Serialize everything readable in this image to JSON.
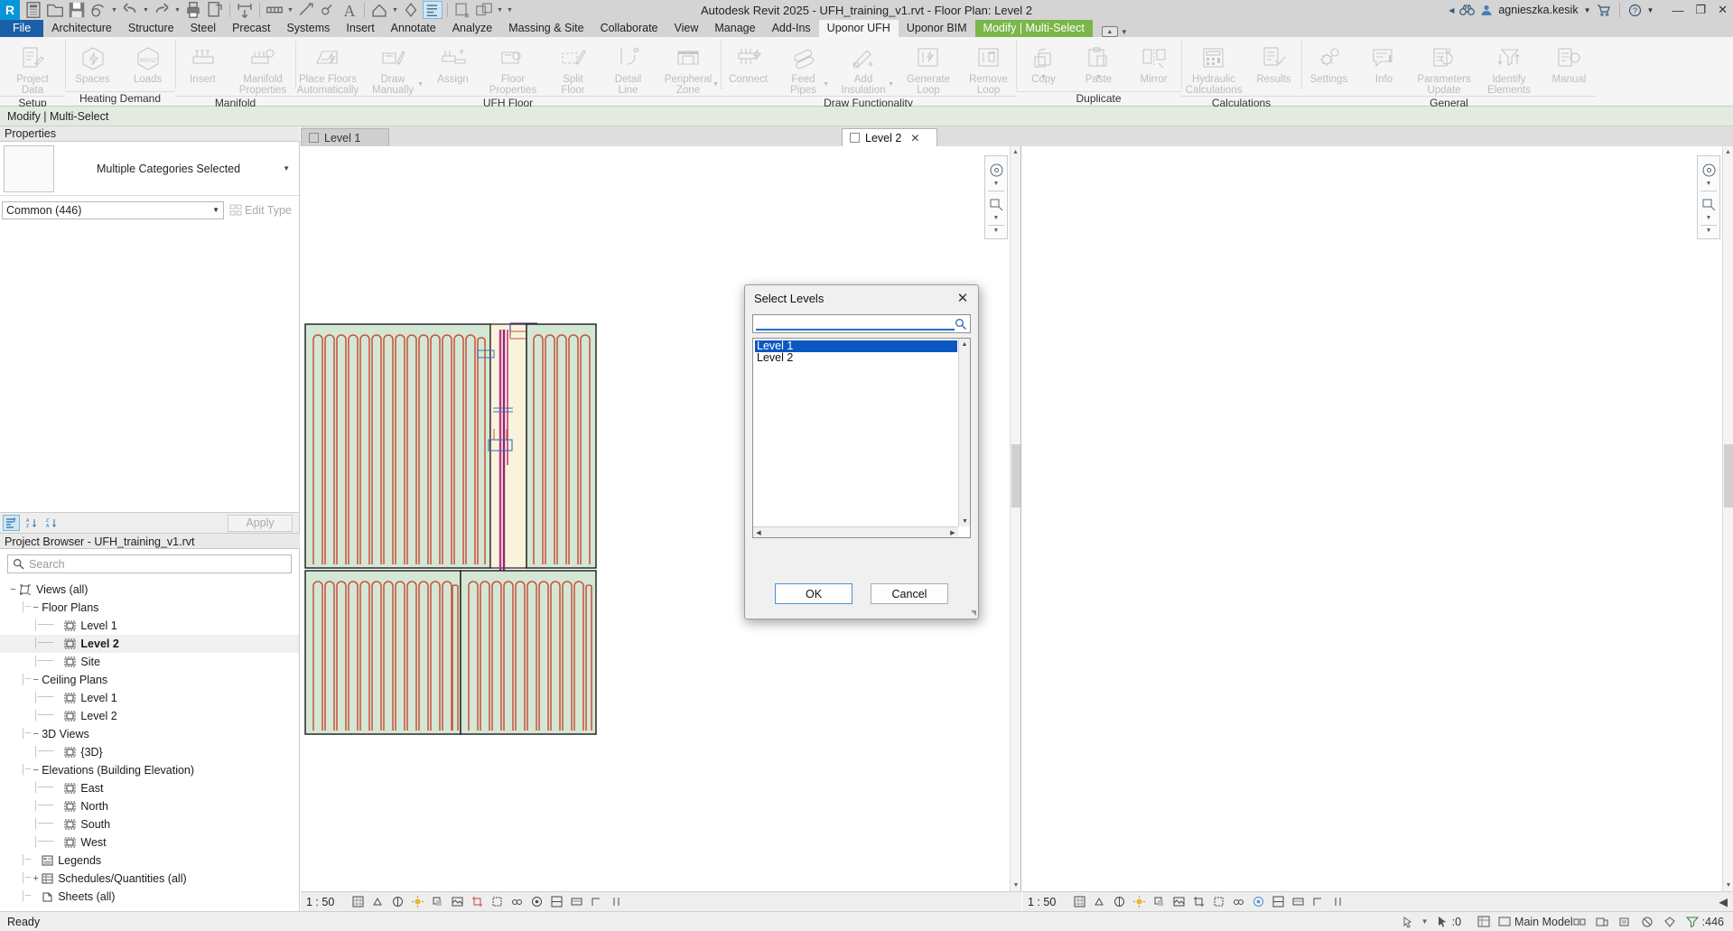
{
  "title_bar": {
    "app_title": "Autodesk Revit 2025 - UFH_training_v1.rvt - Floor Plan: Level 2",
    "user_name": "agnieszka.kesik",
    "quick_access": [
      {
        "name": "revit-logo",
        "label": "R"
      },
      {
        "name": "project-data-icon",
        "label": ""
      },
      {
        "name": "open-icon",
        "label": ""
      },
      {
        "name": "save-icon",
        "label": ""
      },
      {
        "name": "sync-icon",
        "label": ""
      },
      {
        "name": "undo-icon",
        "label": ""
      },
      {
        "name": "redo-icon",
        "label": ""
      },
      {
        "name": "print-icon",
        "label": ""
      },
      {
        "name": "measure-icon",
        "label": ""
      },
      {
        "name": "aligned-dimension-icon",
        "label": ""
      },
      {
        "name": "tag-icon",
        "label": ""
      },
      {
        "name": "text-icon",
        "label": ""
      },
      {
        "name": "default-3d-view-icon",
        "label": ""
      },
      {
        "name": "section-icon",
        "label": ""
      },
      {
        "name": "thin-lines-icon",
        "label": ""
      },
      {
        "name": "close-hidden-windows-icon",
        "label": ""
      },
      {
        "name": "switch-windows-icon",
        "label": ""
      }
    ],
    "window_buttons": {
      "minimize": "—",
      "restore": "❐",
      "close": "✕"
    }
  },
  "ribbon_tabs": {
    "file": "File",
    "tabs": [
      "Architecture",
      "Structure",
      "Steel",
      "Precast",
      "Systems",
      "Insert",
      "Annotate",
      "Analyze",
      "Massing & Site",
      "Collaborate",
      "View",
      "Manage",
      "Add-Ins"
    ],
    "active_tab": "Uponor UFH",
    "secondary_tab": "Uponor BIM",
    "context_tab": "Modify | Multi-Select"
  },
  "ribbon": {
    "groups": [
      {
        "title": "Setup",
        "buttons": [
          {
            "name": "project-data-button",
            "label": "Project\nData",
            "icon": "document-edit-icon",
            "dropdown": "none"
          }
        ]
      },
      {
        "title": "Heating Demand",
        "buttons": [
          {
            "name": "spaces-button",
            "label": "Spaces",
            "icon": "space-bolt-icon",
            "dropdown": "none"
          },
          {
            "name": "loads-button",
            "label": "Loads",
            "icon": "space-wm2-icon",
            "dropdown": "none"
          }
        ]
      },
      {
        "title": "Manifold",
        "buttons": [
          {
            "name": "insert-manifold-button",
            "label": "Insert",
            "icon": "manifold-icon",
            "dropdown": "none"
          },
          {
            "name": "manifold-properties-button",
            "label": "Manifold\nProperties",
            "icon": "manifold-gear-icon",
            "dropdown": "none"
          }
        ]
      },
      {
        "title": "UFH Floor",
        "buttons": [
          {
            "name": "place-floors-automatically-button",
            "label": "Place Floors\nAutomatically",
            "icon": "floor-bolt-icon",
            "dropdown": "none"
          },
          {
            "name": "draw-manually-button",
            "label": "Draw\nManually",
            "icon": "floor-pencil-icon",
            "dropdown": "side"
          },
          {
            "name": "assign-button",
            "label": "Assign",
            "icon": "manifold-plus-icon",
            "dropdown": "none"
          },
          {
            "name": "floor-properties-button",
            "label": "Floor\nProperties",
            "icon": "floor-gear-icon",
            "dropdown": "none"
          },
          {
            "name": "split-floor-button",
            "label": "Split\nFloor",
            "icon": "split-floor-icon",
            "dropdown": "none"
          },
          {
            "name": "detail-line-button",
            "label": "Detail\nLine",
            "icon": "detail-line-icon",
            "dropdown": "none"
          },
          {
            "name": "peripheral-zone-button",
            "label": "Peripheral\nZone",
            "icon": "peripheral-zone-icon",
            "dropdown": "side"
          }
        ]
      },
      {
        "title": "Draw Functionality",
        "buttons": [
          {
            "name": "connect-button",
            "label": "Connect",
            "icon": "manifold-connect-icon",
            "dropdown": "none"
          },
          {
            "name": "feed-pipes-button",
            "label": "Feed\nPipes",
            "icon": "pipes-icon",
            "dropdown": "side"
          },
          {
            "name": "add-insulation-button",
            "label": "Add\nInsulation",
            "icon": "insulation-plus-icon",
            "dropdown": "side"
          },
          {
            "name": "generate-loop-button",
            "label": "Generate\nLoop",
            "icon": "loop-bolt-icon",
            "dropdown": "none"
          },
          {
            "name": "remove-loop-button",
            "label": "Remove\nLoop",
            "icon": "loop-trash-icon",
            "dropdown": "none"
          }
        ]
      },
      {
        "title": "Duplicate",
        "buttons": [
          {
            "name": "copy-button",
            "label": "Copy",
            "icon": "copy-icon",
            "dropdown": "below"
          },
          {
            "name": "paste-button",
            "label": "Paste",
            "icon": "paste-icon",
            "dropdown": "below"
          },
          {
            "name": "mirror-button",
            "label": "Mirror",
            "icon": "mirror-icon",
            "dropdown": "none"
          }
        ]
      },
      {
        "title": "Calculations",
        "buttons": [
          {
            "name": "hydraulic-calculations-button",
            "label": "Hydraulic\nCalculations",
            "icon": "calculator-icon",
            "dropdown": "none"
          },
          {
            "name": "results-button",
            "label": "Results",
            "icon": "results-check-icon",
            "dropdown": "none"
          }
        ]
      },
      {
        "title": "General",
        "buttons": [
          {
            "name": "settings-button",
            "label": "Settings",
            "icon": "gear-icon",
            "dropdown": "none"
          },
          {
            "name": "info-button",
            "label": "Info",
            "icon": "info-bubble-icon",
            "dropdown": "none"
          },
          {
            "name": "parameters-update-button",
            "label": "Parameters\nUpdate",
            "icon": "document-refresh-icon",
            "dropdown": "none"
          },
          {
            "name": "identify-elements-button",
            "label": "Identify\nElements",
            "icon": "filter-arrows-icon",
            "dropdown": "none"
          },
          {
            "name": "manual-button",
            "label": "Manual",
            "icon": "document-gear-icon",
            "dropdown": "none"
          }
        ]
      }
    ]
  },
  "options_bar": {
    "text": "Modify | Multi-Select"
  },
  "properties": {
    "header": "Properties",
    "type_label": "Multiple Categories Selected",
    "instance_selector": "Common (446)",
    "edit_type_label": "Edit Type",
    "apply_label": "Apply",
    "toolbar_icons": [
      "properties-list-icon",
      "sort-ascending-icon",
      "sort-descending-icon"
    ]
  },
  "project_browser": {
    "header": "Project Browser - UFH_training_v1.rvt",
    "search_placeholder": "Search",
    "tree": [
      {
        "label": "Views (all)",
        "depth": 0,
        "expander": "−",
        "icon": "views-icon",
        "selected": false,
        "bold": false
      },
      {
        "label": "Floor Plans",
        "depth": 1,
        "expander": "−",
        "icon": "none",
        "selected": false,
        "bold": false
      },
      {
        "label": "Level 1",
        "depth": 2,
        "expander": "",
        "icon": "view-icon",
        "selected": false,
        "bold": false
      },
      {
        "label": "Level 2",
        "depth": 2,
        "expander": "",
        "icon": "view-icon",
        "selected": true,
        "bold": true
      },
      {
        "label": "Site",
        "depth": 2,
        "expander": "",
        "icon": "view-icon",
        "selected": false,
        "bold": false
      },
      {
        "label": "Ceiling Plans",
        "depth": 1,
        "expander": "−",
        "icon": "none",
        "selected": false,
        "bold": false
      },
      {
        "label": "Level 1",
        "depth": 2,
        "expander": "",
        "icon": "view-icon",
        "selected": false,
        "bold": false
      },
      {
        "label": "Level 2",
        "depth": 2,
        "expander": "",
        "icon": "view-icon",
        "selected": false,
        "bold": false
      },
      {
        "label": "3D Views",
        "depth": 1,
        "expander": "−",
        "icon": "none",
        "selected": false,
        "bold": false
      },
      {
        "label": "{3D}",
        "depth": 2,
        "expander": "",
        "icon": "view-icon",
        "selected": false,
        "bold": false
      },
      {
        "label": "Elevations (Building Elevation)",
        "depth": 1,
        "expander": "−",
        "icon": "none",
        "selected": false,
        "bold": false
      },
      {
        "label": "East",
        "depth": 2,
        "expander": "",
        "icon": "view-icon",
        "selected": false,
        "bold": false
      },
      {
        "label": "North",
        "depth": 2,
        "expander": "",
        "icon": "view-icon",
        "selected": false,
        "bold": false
      },
      {
        "label": "South",
        "depth": 2,
        "expander": "",
        "icon": "view-icon",
        "selected": false,
        "bold": false
      },
      {
        "label": "West",
        "depth": 2,
        "expander": "",
        "icon": "view-icon",
        "selected": false,
        "bold": false
      },
      {
        "label": "Legends",
        "depth": 1,
        "expander": "",
        "icon": "legend-icon",
        "selected": false,
        "bold": false
      },
      {
        "label": "Schedules/Quantities (all)",
        "depth": 1,
        "expander": "+",
        "icon": "schedule-icon",
        "selected": false,
        "bold": false
      },
      {
        "label": "Sheets (all)",
        "depth": 1,
        "expander": "",
        "icon": "sheet-icon",
        "selected": false,
        "bold": false
      }
    ]
  },
  "view_tabs": [
    {
      "label": "Level 1",
      "active": false,
      "closable": false
    },
    {
      "label": "Level 2",
      "active": true,
      "closable": true
    }
  ],
  "view_control_bars": {
    "left": {
      "scale": "1 : 50"
    },
    "right": {
      "scale": "1 : 50"
    },
    "icons": [
      "view-scale-icon",
      "detail-level-icon",
      "visual-style-icon",
      "sun-path-icon",
      "shadows-icon",
      "rendering-icon",
      "crop-view-icon",
      "crop-region-icon",
      "analytical-model-icon",
      "hide-isolate-icon",
      "worksharing-display-icon",
      "temporary-view-icon",
      "reveal-constraints-icon"
    ]
  },
  "status_bar": {
    "ready_text": "Ready",
    "selection_count": ":0",
    "model_label": "Main Model",
    "filter_count": ":446",
    "right_icons": [
      "worksets-icon",
      "design-options-icon",
      "editable-only-icon",
      "exclude-options-icon",
      "active-only-icon",
      "filter-icon"
    ]
  },
  "dialog": {
    "title": "Select Levels",
    "search_value": "",
    "items": [
      {
        "label": "Level 1",
        "selected": true
      },
      {
        "label": "Level 2",
        "selected": false
      }
    ],
    "ok_label": "OK",
    "cancel_label": "Cancel"
  },
  "colors": {
    "accent_blue": "#0696d7",
    "file_tab_blue": "#1b5fa8",
    "context_tab_green": "#7ab648",
    "selection_blue": "#0b57c2",
    "options_bar_green": "#e3ebe0",
    "pipe_red": "#c8503c",
    "floor_green": "#d4e7d4",
    "floor_cream": "#faf3dc",
    "feed_pipe_magenta": "#c0338c"
  }
}
